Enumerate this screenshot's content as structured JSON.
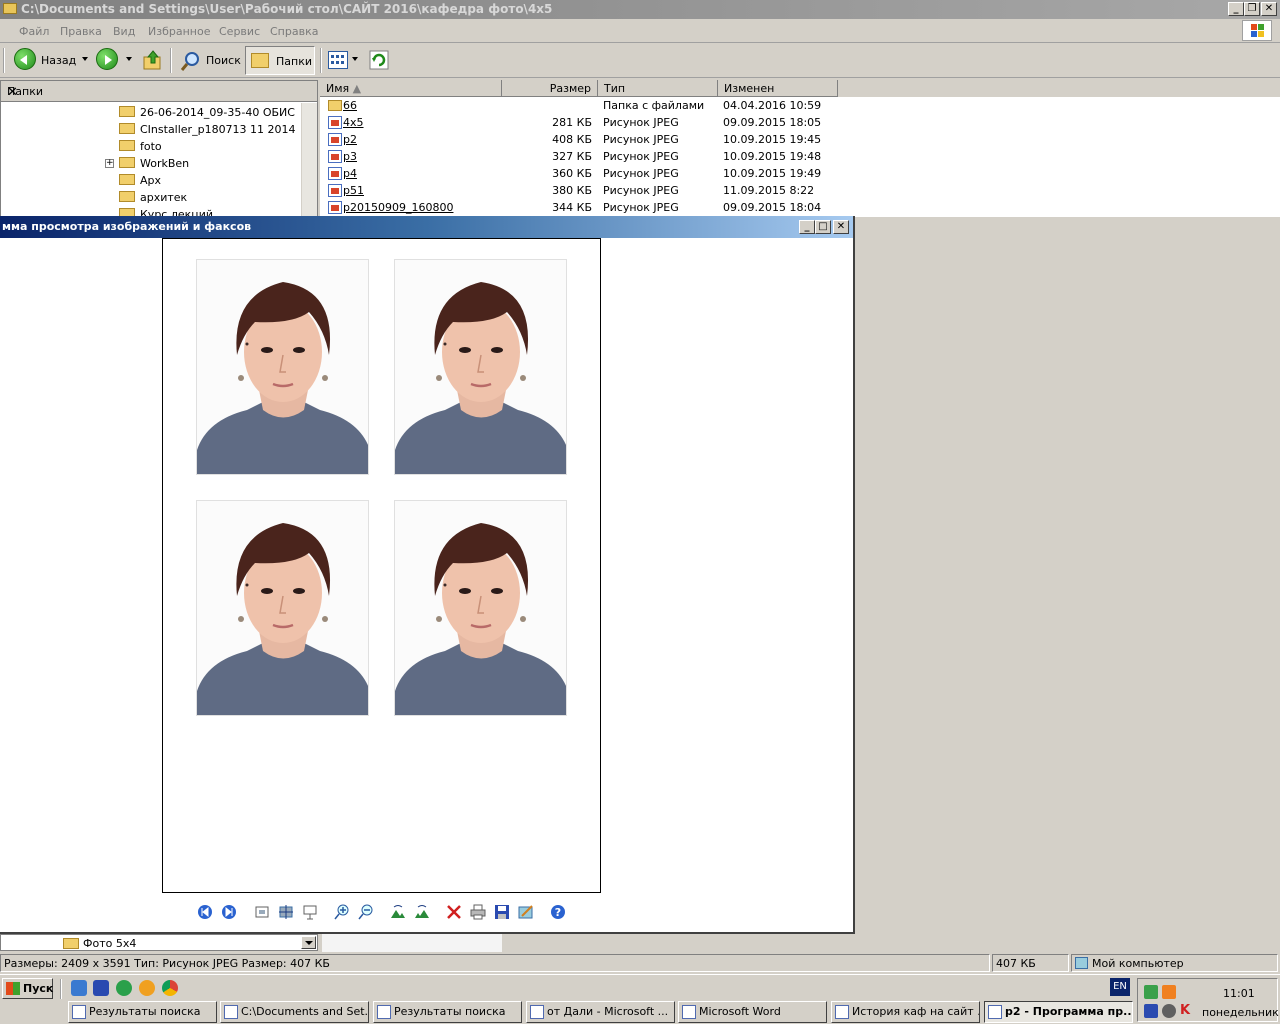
{
  "explorer": {
    "title": "C:\\Documents and Settings\\User\\Рабочий стол\\САЙТ 2016\\кафедра фото\\4x5",
    "menu": [
      "Файл",
      "Правка",
      "Вид",
      "Избранное",
      "Сервис",
      "Справка"
    ],
    "toolbar": {
      "back_label": "Назад",
      "search_label": "Поиск",
      "folders_label": "Папки"
    },
    "folders_panel": {
      "title": "Папки",
      "items": [
        "26-06-2014_09-35-40 ОБИС",
        "CInstaller_p180713 11 2014",
        "foto",
        "WorkBen",
        "Арх",
        "архитек",
        "Курс лекций"
      ]
    },
    "columns": {
      "name": "Имя",
      "size": "Размер",
      "type": "Тип",
      "modified": "Изменен"
    },
    "files": [
      {
        "name": "66",
        "size": "",
        "type": "Папка с файлами",
        "modified": "04.04.2016 10:59",
        "icon": "folder-icon"
      },
      {
        "name": "4x5",
        "size": "281 КБ",
        "type": "Рисунок JPEG",
        "modified": "09.09.2015 18:05",
        "icon": "jpeg-icon"
      },
      {
        "name": "p2",
        "size": "408 КБ",
        "type": "Рисунок JPEG",
        "modified": "10.09.2015 19:45",
        "icon": "jpeg-icon"
      },
      {
        "name": "p3",
        "size": "327 КБ",
        "type": "Рисунок JPEG",
        "modified": "10.09.2015 19:48",
        "icon": "jpeg-icon"
      },
      {
        "name": "p4",
        "size": "360 КБ",
        "type": "Рисунок JPEG",
        "modified": "10.09.2015 19:49",
        "icon": "jpeg-icon"
      },
      {
        "name": "p51",
        "size": "380 КБ",
        "type": "Рисунок JPEG",
        "modified": "11.09.2015 8:22",
        "icon": "jpeg-icon"
      },
      {
        "name": "p20150909_160800",
        "size": "344 КБ",
        "type": "Рисунок JPEG",
        "modified": "09.09.2015 18:04",
        "icon": "jpeg-icon"
      }
    ],
    "address_bottom": "Фото 5x4",
    "status": {
      "details": "Размеры: 2409 x 3591 Тип: Рисунок JPEG Размер: 407 КБ",
      "size": "407 КБ",
      "location": "Мой компьютер"
    }
  },
  "viewer": {
    "title": "мма просмотра изображений и факсов",
    "photo_count": 4
  },
  "taskbar": {
    "start_label": "Пуск",
    "lang": "EN",
    "time": "11:01",
    "day": "понедельник",
    "tasks": [
      {
        "label": "Результаты поиска",
        "active": false
      },
      {
        "label": "C:\\Documents and Set...",
        "active": false
      },
      {
        "label": "Результаты поиска",
        "active": false
      },
      {
        "label": "от Дали - Microsoft ...",
        "active": false
      },
      {
        "label": "Microsoft Word",
        "active": false
      },
      {
        "label": "История каф на сайт ...",
        "active": false
      },
      {
        "label": "p2 - Программа пр...",
        "active": true
      }
    ]
  },
  "colors": {
    "viewer_title_start": "#0a246a",
    "viewer_title_end": "#a6caf0",
    "inactive_title": "#808080"
  }
}
